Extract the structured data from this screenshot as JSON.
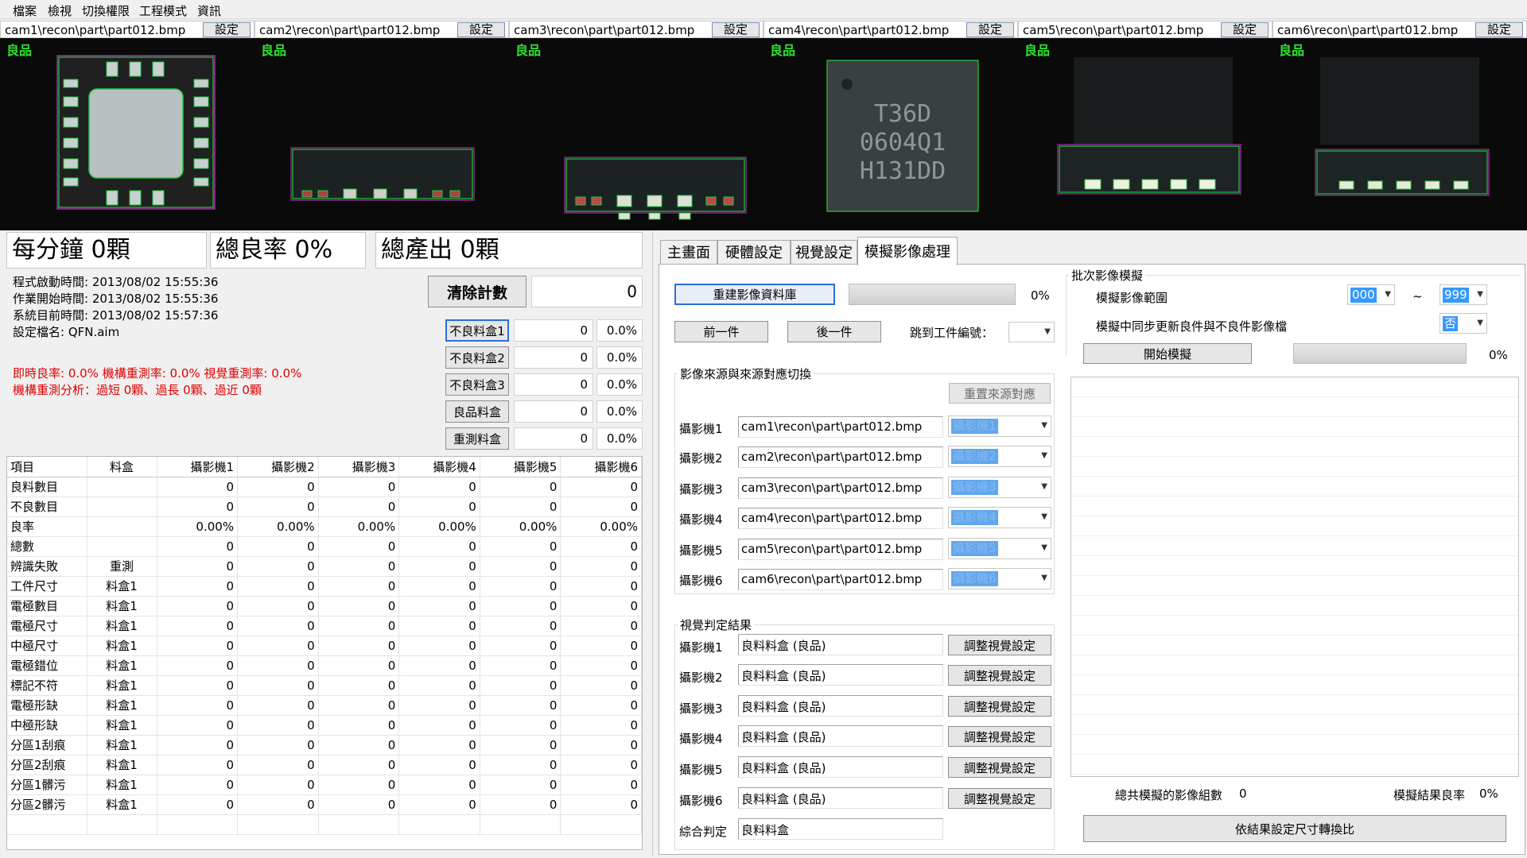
{
  "menu": [
    "檔案",
    "檢視",
    "切換權限",
    "工程模式",
    "資訊"
  ],
  "cameras": [
    {
      "name": "cam1\\recon\\part\\part012.bmp",
      "button": "設定",
      "status": "良品"
    },
    {
      "name": "cam2\\recon\\part\\part012.bmp",
      "button": "設定",
      "status": "良品"
    },
    {
      "name": "cam3\\recon\\part\\part012.bmp",
      "button": "設定",
      "status": "良品"
    },
    {
      "name": "cam4\\recon\\part\\part012.bmp",
      "button": "設定",
      "status": "良品"
    },
    {
      "name": "cam5\\recon\\part\\part012.bmp",
      "button": "設定",
      "status": "良品"
    },
    {
      "name": "cam6\\recon\\part\\part012.bmp",
      "button": "設定",
      "status": "良品"
    }
  ],
  "chip_marking": {
    "line1": "T36D",
    "line2": "0604Q1",
    "line3": "H131DD"
  },
  "stats": {
    "per_minute": "每分鐘 0顆",
    "yield": "總良率 0%",
    "total_output": "總產出 0顆"
  },
  "info": {
    "start_time": "程式啟動時間: 2013/08/02 15:55:36",
    "job_start": "作業開始時間: 2013/08/02 15:55:36",
    "system_time": "系統目前時間: 2013/08/02 15:57:36",
    "config": "設定檔名: QFN.aim",
    "realtime": "即時良率: 0.0%  機構重測率: 0.0% 視覺重測率: 0.0%",
    "analysis": "機構重測分析：過短 0顆、過長 0顆、過近 0顆"
  },
  "counter": {
    "clear_label": "清除計數",
    "value": "0"
  },
  "bins": [
    {
      "label": "不良料盒1",
      "count": "0",
      "pct": "0.0%"
    },
    {
      "label": "不良料盒2",
      "count": "0",
      "pct": "0.0%"
    },
    {
      "label": "不良料盒3",
      "count": "0",
      "pct": "0.0%"
    },
    {
      "label": "良品料盒",
      "count": "0",
      "pct": "0.0%"
    },
    {
      "label": "重測料盒",
      "count": "0",
      "pct": "0.0%"
    }
  ],
  "table": {
    "headers": [
      "項目",
      "料盒",
      "攝影機1",
      "攝影機2",
      "攝影機3",
      "攝影機4",
      "攝影機5",
      "攝影機6"
    ],
    "rows": [
      [
        "良料數目",
        "",
        "0",
        "0",
        "0",
        "0",
        "0",
        "0"
      ],
      [
        "不良數目",
        "",
        "0",
        "0",
        "0",
        "0",
        "0",
        "0"
      ],
      [
        "良率",
        "",
        "0.00%",
        "0.00%",
        "0.00%",
        "0.00%",
        "0.00%",
        "0.00%"
      ],
      [
        "總數",
        "",
        "0",
        "0",
        "0",
        "0",
        "0",
        "0"
      ],
      [
        "辨識失敗",
        "重測",
        "0",
        "0",
        "0",
        "0",
        "0",
        "0"
      ],
      [
        "工件尺寸",
        "料盒1",
        "0",
        "0",
        "0",
        "0",
        "0",
        "0"
      ],
      [
        "電極數目",
        "料盒1",
        "0",
        "0",
        "0",
        "0",
        "0",
        "0"
      ],
      [
        "電極尺寸",
        "料盒1",
        "0",
        "0",
        "0",
        "0",
        "0",
        "0"
      ],
      [
        "中極尺寸",
        "料盒1",
        "0",
        "0",
        "0",
        "0",
        "0",
        "0"
      ],
      [
        "電極錯位",
        "料盒1",
        "0",
        "0",
        "0",
        "0",
        "0",
        "0"
      ],
      [
        "標記不符",
        "料盒1",
        "0",
        "0",
        "0",
        "0",
        "0",
        "0"
      ],
      [
        "電極形缺",
        "料盒1",
        "0",
        "0",
        "0",
        "0",
        "0",
        "0"
      ],
      [
        "中極形缺",
        "料盒1",
        "0",
        "0",
        "0",
        "0",
        "0",
        "0"
      ],
      [
        "分區1刮痕",
        "料盒1",
        "0",
        "0",
        "0",
        "0",
        "0",
        "0"
      ],
      [
        "分區2刮痕",
        "料盒1",
        "0",
        "0",
        "0",
        "0",
        "0",
        "0"
      ],
      [
        "分區1髒污",
        "料盒1",
        "0",
        "0",
        "0",
        "0",
        "0",
        "0"
      ],
      [
        "分區2髒污",
        "料盒1",
        "0",
        "0",
        "0",
        "0",
        "0",
        "0"
      ]
    ]
  },
  "tabs": [
    "主畫面",
    "硬體設定",
    "視覺設定",
    "模擬影像處理"
  ],
  "active_tab": 3,
  "sim": {
    "rebuild_label": "重建影像資料庫",
    "rebuild_progress": 0,
    "rebuild_progress_text": "0%",
    "prev_label": "前一件",
    "next_label": "後一件",
    "jump_label": "跳到工件編號：",
    "source_group_title": "影像來源與來源對應切換",
    "reset_label": "重置來源對應",
    "sources": [
      {
        "label": "攝影機1",
        "path": "cam1\\recon\\part\\part012.bmp",
        "map": "攝影機1"
      },
      {
        "label": "攝影機2",
        "path": "cam2\\recon\\part\\part012.bmp",
        "map": "攝影機2"
      },
      {
        "label": "攝影機3",
        "path": "cam3\\recon\\part\\part012.bmp",
        "map": "攝影機3"
      },
      {
        "label": "攝影機4",
        "path": "cam4\\recon\\part\\part012.bmp",
        "map": "攝影機4"
      },
      {
        "label": "攝影機5",
        "path": "cam5\\recon\\part\\part012.bmp",
        "map": "攝影機5"
      },
      {
        "label": "攝影機6",
        "path": "cam6\\recon\\part\\part012.bmp",
        "map": "攝影機6"
      }
    ],
    "result_group_title": "視覺判定結果",
    "results": [
      {
        "label": "攝影機1",
        "value": "良料料盒 (良品)",
        "button": "調整視覺設定"
      },
      {
        "label": "攝影機2",
        "value": "良料料盒 (良品)",
        "button": "調整視覺設定"
      },
      {
        "label": "攝影機3",
        "value": "良料料盒 (良品)",
        "button": "調整視覺設定"
      },
      {
        "label": "攝影機4",
        "value": "良料料盒 (良品)",
        "button": "調整視覺設定"
      },
      {
        "label": "攝影機5",
        "value": "良料料盒 (良品)",
        "button": "調整視覺設定"
      },
      {
        "label": "攝影機6",
        "value": "良料料盒 (良品)",
        "button": "調整視覺設定"
      }
    ],
    "overall_label": "綜合判定",
    "overall_value": "良料料盒",
    "batch_group_title": "批次影像模擬",
    "range_label": "模擬影像範圍",
    "range_from": "000",
    "range_sep": "~",
    "range_to": "999",
    "sync_label": "模擬中同步更新良件與不良件影像檔",
    "sync_value": "否",
    "start_label": "開始模擬",
    "batch_progress": 0,
    "batch_progress_text": "0%",
    "total_label": "總共模擬的影像組數",
    "total_value": "0",
    "yield_label": "模擬結果良率",
    "yield_value": "0%",
    "convert_label": "依結果設定尺寸轉換比"
  },
  "colors": {
    "ok_green": "#2fe02f",
    "frame_green": "#22cc44",
    "roi_magenta": "#cc33cc",
    "highlight": "#3399ff",
    "alert_red": "#e00000"
  }
}
